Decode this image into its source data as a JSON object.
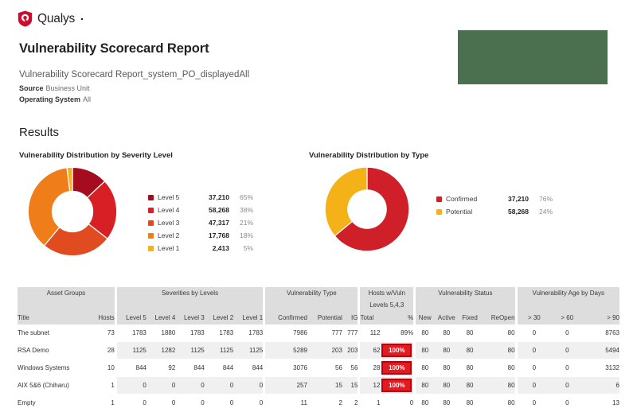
{
  "brand": {
    "logo_text": "Qualys",
    "logo_icon": "qualys-shield-icon",
    "accent_red": "#c8102e",
    "green_panel_color": "#4a7050"
  },
  "header": {
    "report_title": "Vulnerability Scorecard Report",
    "report_subtitle": "Vulnerability Scorecard Report_system_PO_displayedAll",
    "meta": [
      {
        "key": "Source",
        "value": "Business Unit"
      },
      {
        "key": "Operating System",
        "value": "All"
      }
    ]
  },
  "results": {
    "heading": "Results"
  },
  "chart_data": [
    {
      "type": "pie",
      "title": "Vulnerability Distribution by Severity Level",
      "legend_position": "right",
      "categories": [
        "Level 5",
        "Level 4",
        "Level 3",
        "Level 2",
        "Level 1"
      ],
      "values": [
        37210,
        58268,
        47317,
        17768,
        2413
      ],
      "value_labels": [
        "37,210",
        "58,268",
        "47,317",
        "17,768",
        "2,413"
      ],
      "percent_labels": [
        "65%",
        "38%",
        "21%",
        "18%",
        "5%"
      ],
      "percents": [
        65,
        38,
        21,
        18,
        5
      ],
      "slice_fractions": [
        0.13,
        0.225,
        0.255,
        0.37,
        0.02
      ],
      "colors": [
        "#a50d1e",
        "#d81f26",
        "#e14b20",
        "#ef7d1a",
        "#f5b218"
      ]
    },
    {
      "type": "pie",
      "title": "Vulnerability Distribution by Type",
      "legend_position": "right",
      "categories": [
        "Confirmed",
        "Potential"
      ],
      "values": [
        37210,
        58268
      ],
      "value_labels": [
        "37,210",
        "58,268"
      ],
      "percent_labels": [
        "76%",
        "24%"
      ],
      "percents": [
        76,
        24
      ],
      "slice_fractions": [
        0.64,
        0.36
      ],
      "colors": [
        "#cf1f28",
        "#f5b218"
      ]
    }
  ],
  "table": {
    "group_headers": [
      {
        "label": "Asset Groups",
        "span": 2
      },
      {
        "label": "Severities by Levels",
        "span": 5
      },
      {
        "label": "Vulnerability Type",
        "span": 3
      },
      {
        "label": "Hosts w/Vuln Levels 5,4,3",
        "span": 2,
        "line1": "Hosts w/Vuln",
        "line2": "Levels 5,4,3"
      },
      {
        "label": "Vulnerability Status",
        "span": 4
      },
      {
        "label": "Vulnerability Age by Days",
        "span": 3
      }
    ],
    "columns": [
      "Title",
      "Hosts",
      "Level 5",
      "Level 4",
      "Level 3",
      "Level 2",
      "Level 1",
      "Confirmed",
      "Potential",
      "IG",
      "Total",
      "%",
      "New",
      "Active",
      "Fixed",
      "ReOpen",
      "> 30",
      "> 60",
      "> 90"
    ],
    "rows": [
      {
        "title": "The subnet",
        "hosts": "73",
        "level5": "1783",
        "level4": "1880",
        "level3": "1783",
        "level2": "1783",
        "level1": "1783",
        "confirmed": "7986",
        "potential": "777",
        "ig": "777",
        "total": "112",
        "pct": "89%",
        "pct_alert": false,
        "new": "80",
        "active": "80",
        "fixed": "80",
        "reopen": "80",
        "d30": "0",
        "d60": "0",
        "d90": "8763"
      },
      {
        "title": "RSA Demo",
        "hosts": "28",
        "level5": "1125",
        "level4": "1282",
        "level3": "1125",
        "level2": "1125",
        "level1": "1125",
        "confirmed": "5289",
        "potential": "203",
        "ig": "203",
        "total": "62",
        "pct": "100%",
        "pct_alert": true,
        "new": "80",
        "active": "80",
        "fixed": "80",
        "reopen": "80",
        "d30": "0",
        "d60": "0",
        "d90": "5494"
      },
      {
        "title": "Windows Systems",
        "hosts": "10",
        "level5": "844",
        "level4": "92",
        "level3": "844",
        "level2": "844",
        "level1": "844",
        "confirmed": "3076",
        "potential": "56",
        "ig": "56",
        "total": "28",
        "pct": "100%",
        "pct_alert": true,
        "new": "80",
        "active": "80",
        "fixed": "80",
        "reopen": "80",
        "d30": "0",
        "d60": "0",
        "d90": "3132"
      },
      {
        "title": "AIX 5&6 (Chiharu)",
        "hosts": "1",
        "level5": "0",
        "level4": "0",
        "level3": "0",
        "level2": "0",
        "level1": "0",
        "confirmed": "257",
        "potential": "15",
        "ig": "15",
        "total": "12",
        "pct": "100%",
        "pct_alert": true,
        "new": "80",
        "active": "80",
        "fixed": "80",
        "reopen": "80",
        "d30": "0",
        "d60": "0",
        "d90": "6"
      },
      {
        "title": "Empty",
        "hosts": "1",
        "level5": "0",
        "level4": "0",
        "level3": "0",
        "level2": "0",
        "level1": "0",
        "confirmed": "11",
        "potential": "2",
        "ig": "2",
        "total": "1",
        "pct": "0",
        "pct_alert": false,
        "new": "80",
        "active": "80",
        "fixed": "80",
        "reopen": "80",
        "d30": "0",
        "d60": "0",
        "d90": "13"
      }
    ]
  }
}
